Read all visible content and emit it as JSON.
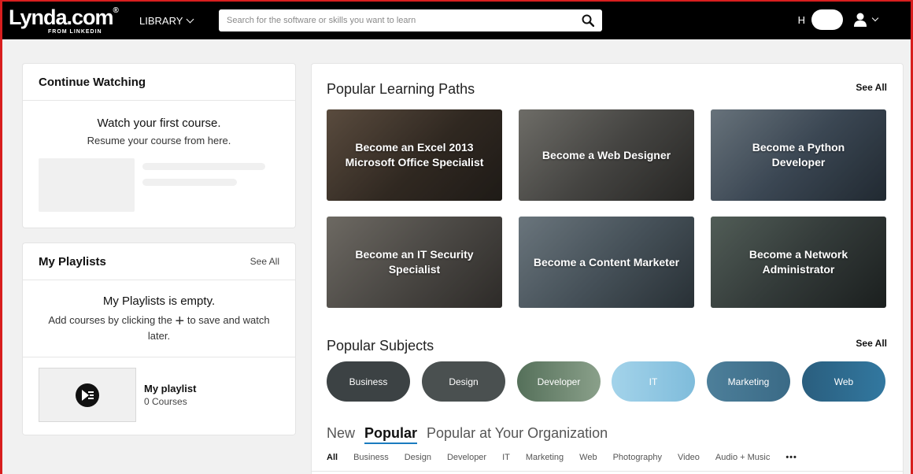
{
  "topbar": {
    "logo_main": "Lynda.com",
    "logo_sub": "FROM LINKEDIN",
    "library_label": "LIBRARY",
    "search_placeholder": "Search for the software or skills you want to learn",
    "user_initial": "H"
  },
  "continue_watching": {
    "title": "Continue Watching",
    "heading": "Watch your first course.",
    "subtext": "Resume your course from here."
  },
  "playlists": {
    "title": "My Playlists",
    "see_all": "See All",
    "empty_heading": "My Playlists is empty.",
    "empty_text_before": "Add courses by clicking the",
    "empty_plus": "+",
    "empty_text_after": "to save and watch later.",
    "item_name": "My playlist",
    "item_count": "0 Courses"
  },
  "learning_paths": {
    "title": "Popular Learning Paths",
    "see_all": "See All",
    "items": [
      {
        "label": "Become an Excel 2013 Microsoft Office Specialist",
        "color": "#5a4e42"
      },
      {
        "label": "Become a Web Designer",
        "color": "#6b6a66"
      },
      {
        "label": "Become a Python Developer",
        "color": "#5b6d80"
      },
      {
        "label": "Become an IT Security Specialist",
        "color": "#74706a"
      },
      {
        "label": "Become a Content Marketer",
        "color": "#6d7e8a"
      },
      {
        "label": "Become a Network Administrator",
        "color": "#4f5a58"
      }
    ]
  },
  "subjects": {
    "title": "Popular Subjects",
    "see_all": "See All",
    "items": [
      {
        "label": "Business",
        "color": "#3c4244"
      },
      {
        "label": "Design",
        "color": "#4a5050"
      },
      {
        "label": "Developer",
        "color": "#6c8a6a"
      },
      {
        "label": "IT",
        "color": "#8ec6e2"
      },
      {
        "label": "Marketing",
        "color": "#3f6f8a"
      },
      {
        "label": "Web",
        "color": "#2d6688"
      }
    ]
  },
  "tabs": {
    "new": "New",
    "popular": "Popular",
    "org": "Popular at Your Organization"
  },
  "filters": [
    "All",
    "Business",
    "Design",
    "Developer",
    "IT",
    "Marketing",
    "Web",
    "Photography",
    "Video",
    "Audio + Music"
  ],
  "filters_more": "•••"
}
